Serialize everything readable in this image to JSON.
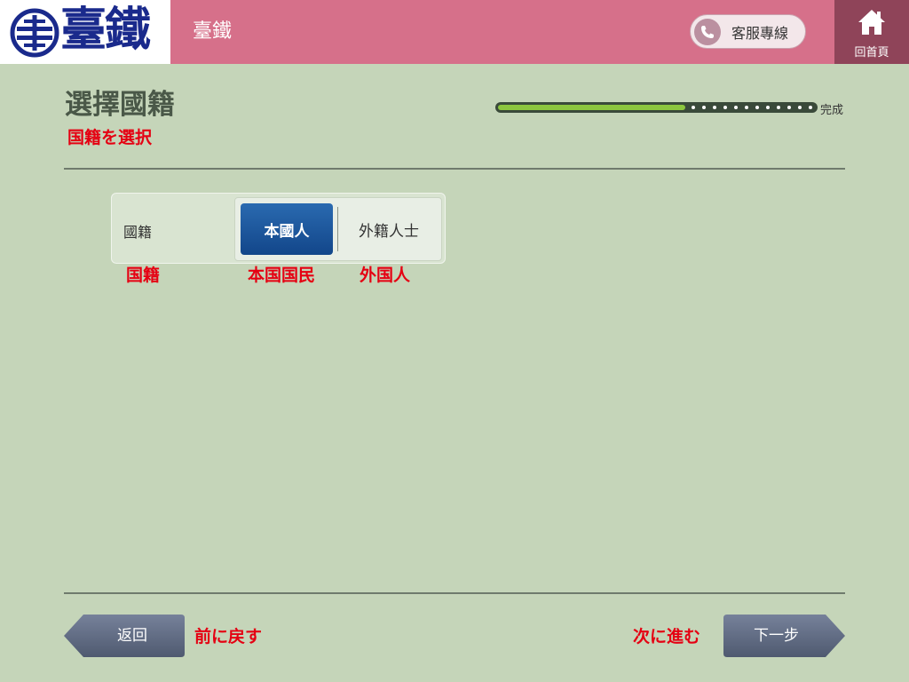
{
  "header": {
    "logo_text": "臺鐵",
    "title": "臺鐵",
    "hotline_label": "客服專線",
    "home_label": "回首頁"
  },
  "page": {
    "title": "選擇國籍",
    "subtitle": "国籍を選択"
  },
  "progress": {
    "fraction": 0.59,
    "dot_count": 12,
    "label": "完成"
  },
  "nationality": {
    "label": "國籍",
    "options": [
      "本國人",
      "外籍人士"
    ],
    "selected": "本國人"
  },
  "annotations": {
    "label": "国籍",
    "option_1": "本国国民",
    "option_2": "外国人",
    "back": "前に戻す",
    "next": "次に進む"
  },
  "nav": {
    "back_label": "返回",
    "next_label": "下一步"
  },
  "colors": {
    "background": "#c5d5b9",
    "header": "#d6708a",
    "home_button": "#8f4459",
    "logo_blue": "#1a2a8c",
    "selected_option": "#1a5aa0",
    "annotation_red": "#e50012",
    "progress_green": "#8cc63f",
    "nav_button": "#5f6a80"
  },
  "icons": {
    "logo": "railway-logo-icon",
    "hotline": "phone-icon",
    "home": "house-icon"
  }
}
